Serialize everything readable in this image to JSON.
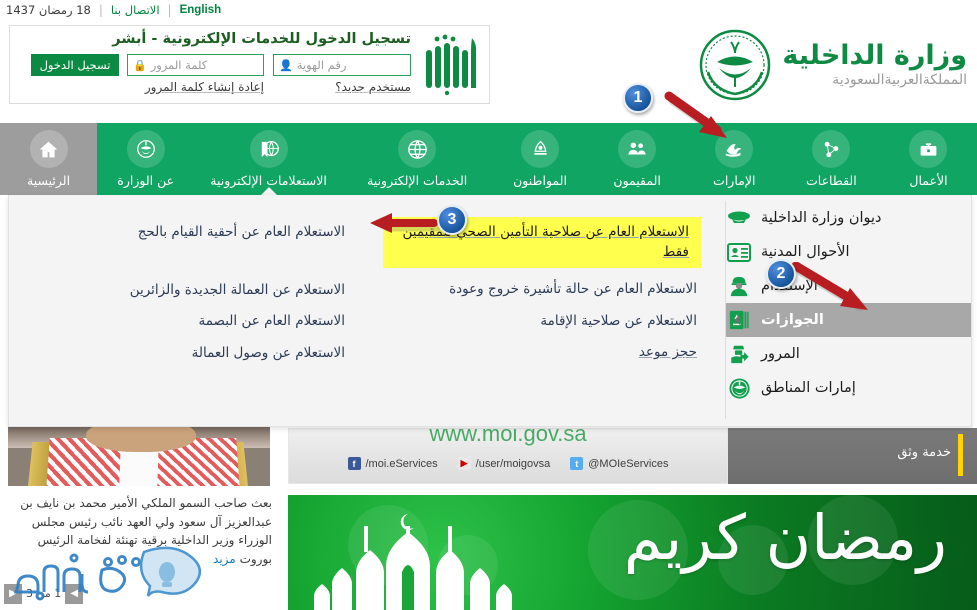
{
  "topbar": {
    "hijri_date": "18 رمضان 1437",
    "contact_label": "الاتصال بنا",
    "english_label": "English",
    "separator": "|"
  },
  "login": {
    "title": "تسجيل الدخول للخدمات الإلكترونية - أبشر",
    "id_placeholder": "رقم الهوية",
    "id_value": "",
    "password_placeholder": "كلمة المرور",
    "password_value": "",
    "submit_label": "تسجيل الدخول",
    "new_user_label": "مستخدم جديد؟",
    "reset_password_label": "إعادة إنشاء كلمة المرور",
    "logo_alt": "أبشر",
    "user_icon": "user-icon",
    "lock_icon": "lock-icon"
  },
  "brand": {
    "ministry_name": "وزارة الداخلية",
    "country": "المملكةالعربيةالسعودية",
    "emblem": "saudi-emblem-icon"
  },
  "nav": {
    "items": [
      {
        "label": "الرئيسية",
        "icon": "home-icon",
        "state": "active-home"
      },
      {
        "label": "عن الوزارة",
        "icon": "ministry-emblem-icon",
        "state": "normal"
      },
      {
        "label": "الاستعلامات الإلكترونية",
        "icon": "globe-flag-icon",
        "state": "open"
      },
      {
        "label": "الخدمات الإلكترونية",
        "icon": "globe-icon",
        "state": "normal"
      },
      {
        "label": "المواطنون",
        "icon": "citizen-icon",
        "state": "normal"
      },
      {
        "label": "المقيمون",
        "icon": "residents-icon",
        "state": "normal"
      },
      {
        "label": "الإمارات",
        "icon": "emirates-icon",
        "state": "normal"
      },
      {
        "label": "القطاعات",
        "icon": "sectors-icon",
        "state": "normal"
      },
      {
        "label": "الأعمال",
        "icon": "briefcase-icon",
        "state": "normal"
      }
    ]
  },
  "mega_menu": {
    "sidebar": [
      {
        "label": "ديوان وزارة الداخلية",
        "icon": "diwan-icon",
        "active": false
      },
      {
        "label": "الأحوال المدنية",
        "icon": "id-card-icon",
        "active": false
      },
      {
        "label": "الإستقدام",
        "icon": "worker-icon",
        "active": false
      },
      {
        "label": "الجوازات",
        "icon": "passport-icon",
        "active": true
      },
      {
        "label": "المرور",
        "icon": "traffic-icon",
        "active": false
      },
      {
        "label": "إمارات المناطق",
        "icon": "regions-icon",
        "active": false
      }
    ],
    "column_right": [
      {
        "label": "الاستعلام العام عن أحقية القيام بالحج",
        "highlighted": false,
        "underline": false
      },
      {
        "label": "الاستعلام عن العمالة الجديدة والزائرين",
        "highlighted": false,
        "underline": false
      },
      {
        "label": "الاستعلام العام عن البصمة",
        "highlighted": false,
        "underline": false
      },
      {
        "label": "الاستعلام عن وصول العمالة",
        "highlighted": false,
        "underline": false
      }
    ],
    "column_left": [
      {
        "label": "الاستعلام العام عن صلاحية التأمين الصحي للمقيمين فقط",
        "highlighted": true,
        "underline": true
      },
      {
        "label": "الاستعلام العام عن حالة تأشيرة خروج وعودة",
        "highlighted": false,
        "underline": false
      },
      {
        "label": "الاستعلام عن صلاحية الإقامة",
        "highlighted": false,
        "underline": false
      },
      {
        "label": "حجز موعد",
        "highlighted": false,
        "underline": true
      }
    ]
  },
  "news": {
    "body": "بعث صاحب السمو الملكي الأمير محمد بن نايف بن عبدالعزيز آل سعود ولي العهد نائب رئيس مجلس الوزراء وزير الداخلية برقية تهنئة لفخامة الرئيس بوروت",
    "more_label": "مزيد",
    "counter": "1 من 3",
    "prev_icon": "chevron-left-icon",
    "next_icon": "chevron-right-icon"
  },
  "social": {
    "url": "www.moi.gov.sa",
    "links": [
      {
        "handle": "/moi.eServices",
        "icon": "facebook-icon",
        "glyph": "f"
      },
      {
        "handle": "/user/moigovsa",
        "icon": "youtube-icon",
        "glyph": "▶"
      },
      {
        "handle": "@MOIeServices",
        "icon": "twitter-icon",
        "glyph": "t"
      }
    ]
  },
  "service_band": {
    "label": "خدمة وثق",
    "accent_color": "#ffd400"
  },
  "banner": {
    "text": "رمضان كريم",
    "alt": "ramadan-kareem-banner"
  },
  "annotations": [
    {
      "number": "1",
      "target": "nav-item-e-inquiries"
    },
    {
      "number": "2",
      "target": "sidebar-item-passports"
    },
    {
      "number": "3",
      "target": "menu-item-health-insurance"
    }
  ],
  "watermark": {
    "text": "تقفني"
  },
  "colors": {
    "brand_green": "#0e8a43",
    "nav_green": "#11a564",
    "active_gray": "#9d9d9d",
    "highlight_yellow": "#ffff4d",
    "link_blue": "#2b3a55",
    "badge_blue": "#17559c",
    "arrow_red": "#b81d21"
  }
}
